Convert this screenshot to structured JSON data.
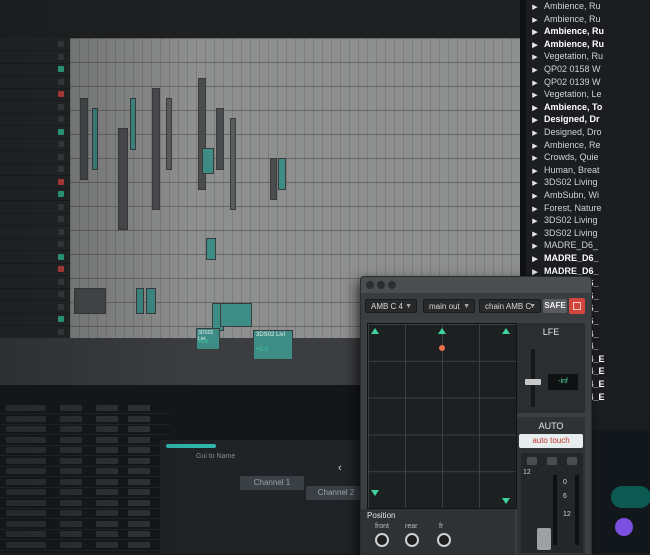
{
  "browser": {
    "items": [
      {
        "label": "Ambience, Ru",
        "bold": false
      },
      {
        "label": "Ambience, Ru",
        "bold": false
      },
      {
        "label": "Ambience, Ru",
        "bold": true
      },
      {
        "label": "Ambience, Ru",
        "bold": true
      },
      {
        "label": "Vegetation, Ru",
        "bold": false
      },
      {
        "label": "QP02 0158 W",
        "bold": false
      },
      {
        "label": "QP02 0139 W",
        "bold": false
      },
      {
        "label": "Vegetation, Le",
        "bold": false
      },
      {
        "label": "Ambience, To",
        "bold": true
      },
      {
        "label": "Designed, Dr",
        "bold": true
      },
      {
        "label": "Designed, Dro",
        "bold": false
      },
      {
        "label": "Ambience, Re",
        "bold": false
      },
      {
        "label": "Crowds, Quie",
        "bold": false
      },
      {
        "label": "Human, Breat",
        "bold": false
      },
      {
        "label": "3DS02 Living",
        "bold": false
      },
      {
        "label": "AmbSubn, Wi",
        "bold": false
      },
      {
        "label": "Forest, Nature",
        "bold": false
      },
      {
        "label": "3DS02 Living",
        "bold": false
      },
      {
        "label": "3DS02 Living",
        "bold": false
      },
      {
        "label": "MADRE_D6_",
        "bold": false
      },
      {
        "label": "MADRE_D6_",
        "bold": true
      },
      {
        "label": "MADRE_D6_",
        "bold": true
      },
      {
        "label": "MADRE_D6_",
        "bold": true
      },
      {
        "label": "MADRE_D6_",
        "bold": true
      },
      {
        "label": "MADRE_D6_",
        "bold": true
      },
      {
        "label": "MADRE_D6_",
        "bold": true
      },
      {
        "label": "MADRE_D4_",
        "bold": true
      },
      {
        "label": "MADRE_D4_",
        "bold": true
      },
      {
        "label": "MADRE_D4_E",
        "bold": true
      },
      {
        "label": "MADRE_D4_E",
        "bold": true
      },
      {
        "label": "MADRE_D4_E",
        "bold": true
      },
      {
        "label": "MADRE_D4_E",
        "bold": true
      }
    ]
  },
  "panner": {
    "input_select": "AMB C 4",
    "output_select": "main out",
    "chain_select": "chain AMB C",
    "safe_label": "SAFE",
    "lfe_label": "LFE",
    "lfe_value": "-inf",
    "auto_label": "AUTO",
    "auto_mode": "auto touch",
    "position_label": "Position",
    "front_label": "front",
    "rear_label": "rear",
    "fr_label": "fr",
    "meter_ticks": [
      "12",
      "0",
      "6",
      "12"
    ]
  },
  "daw": {
    "clip_labels": [
      "3DS02 Livi",
      "3DS02 Livi"
    ],
    "clip_values": [
      "+0.0",
      "+0.0"
    ]
  },
  "lower": {
    "channel_tabs": [
      "Channel 1",
      "Channel 2"
    ],
    "mixer_link": "Gui to Name"
  },
  "colors": {
    "accent_green": "#3ed39c",
    "pan_dot": "#e9704a",
    "safe_red": "#d4463d",
    "auto_text": "#c0392b"
  }
}
